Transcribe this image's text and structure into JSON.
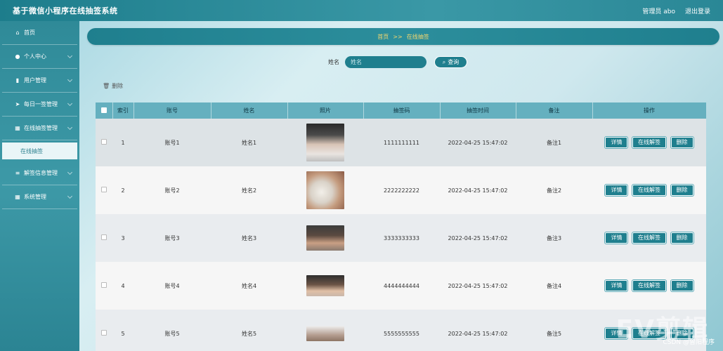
{
  "header": {
    "title": "基于微信小程序在线抽签系统",
    "admin_label": "管理员 abo",
    "logout_label": "退出登录"
  },
  "sidebar": {
    "items": [
      {
        "label": "首页",
        "icon": "home-icon"
      },
      {
        "label": "个人中心",
        "icon": "user-icon"
      },
      {
        "label": "用户管理",
        "icon": "clipboard-icon"
      },
      {
        "label": "每日一签管理",
        "icon": "send-icon"
      },
      {
        "label": "在线抽签管理",
        "icon": "grid-icon"
      },
      {
        "label": "解签信息管理",
        "icon": "list-icon"
      },
      {
        "label": "系统管理",
        "icon": "grid-icon"
      }
    ],
    "sub_item": "在线抽签"
  },
  "breadcrumb": {
    "home": "首页",
    "separator": ">>",
    "current": "在线抽签"
  },
  "search": {
    "label": "姓名",
    "placeholder": "姓名",
    "button_label": "查询"
  },
  "toolbar": {
    "delete_label": "删除"
  },
  "table": {
    "headers": [
      "索引",
      "账号",
      "姓名",
      "照片",
      "抽签码",
      "抽签时间",
      "备注",
      "操作"
    ],
    "actions": [
      "详情",
      "在线解签",
      "删除"
    ],
    "rows": [
      {
        "index": "1",
        "account": "账号1",
        "name": "姓名1",
        "code": "1111111111",
        "time": "2022-04-25 15:47:02",
        "note": "备注1"
      },
      {
        "index": "2",
        "account": "账号2",
        "name": "姓名2",
        "code": "2222222222",
        "time": "2022-04-25 15:47:02",
        "note": "备注2"
      },
      {
        "index": "3",
        "account": "账号3",
        "name": "姓名3",
        "code": "3333333333",
        "time": "2022-04-25 15:47:02",
        "note": "备注3"
      },
      {
        "index": "4",
        "account": "账号4",
        "name": "姓名4",
        "code": "4444444444",
        "time": "2022-04-25 15:47:02",
        "note": "备注4"
      },
      {
        "index": "5",
        "account": "账号5",
        "name": "姓名5",
        "code": "5555555555",
        "time": "2022-04-25 15:47:02",
        "note": "备注5"
      }
    ]
  },
  "watermark": "EV剪辑",
  "credit": "CSDN @曾阳程序",
  "colors": {
    "accent": "#1f7f8e",
    "header_bg": "#65b0bf",
    "breadcrumb_text": "#f5d76e"
  }
}
